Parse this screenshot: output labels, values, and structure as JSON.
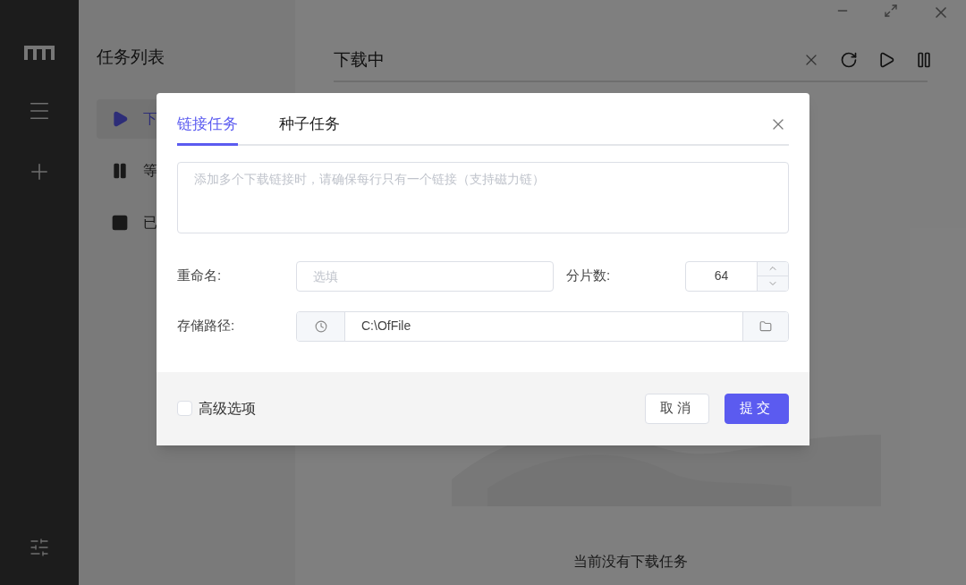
{
  "task_list": {
    "title": "任务列表",
    "items": [
      {
        "label": "下",
        "kind": "downloading",
        "selected": true
      },
      {
        "label": "等",
        "kind": "waiting",
        "selected": false
      },
      {
        "label": "已",
        "kind": "stopped",
        "selected": false
      }
    ]
  },
  "main": {
    "title": "下载中",
    "empty_text": "当前没有下载任务"
  },
  "dialog": {
    "tabs": [
      {
        "label": "链接任务",
        "selected": true
      },
      {
        "label": "种子任务",
        "selected": false
      }
    ],
    "links": {
      "placeholder": "添加多个下载链接时，请确保每行只有一个链接（支持磁力链）"
    },
    "rename": {
      "label": "重命名:",
      "placeholder": "选填"
    },
    "split": {
      "label": "分片数:",
      "value": "64"
    },
    "path": {
      "label": "存储路径:",
      "value": "C:\\OfFile"
    },
    "advanced": {
      "label": "高级选项",
      "checked": false
    },
    "buttons": [
      {
        "label": "取消",
        "kind": "secondary"
      },
      {
        "label": "提交",
        "kind": "primary"
      }
    ]
  }
}
